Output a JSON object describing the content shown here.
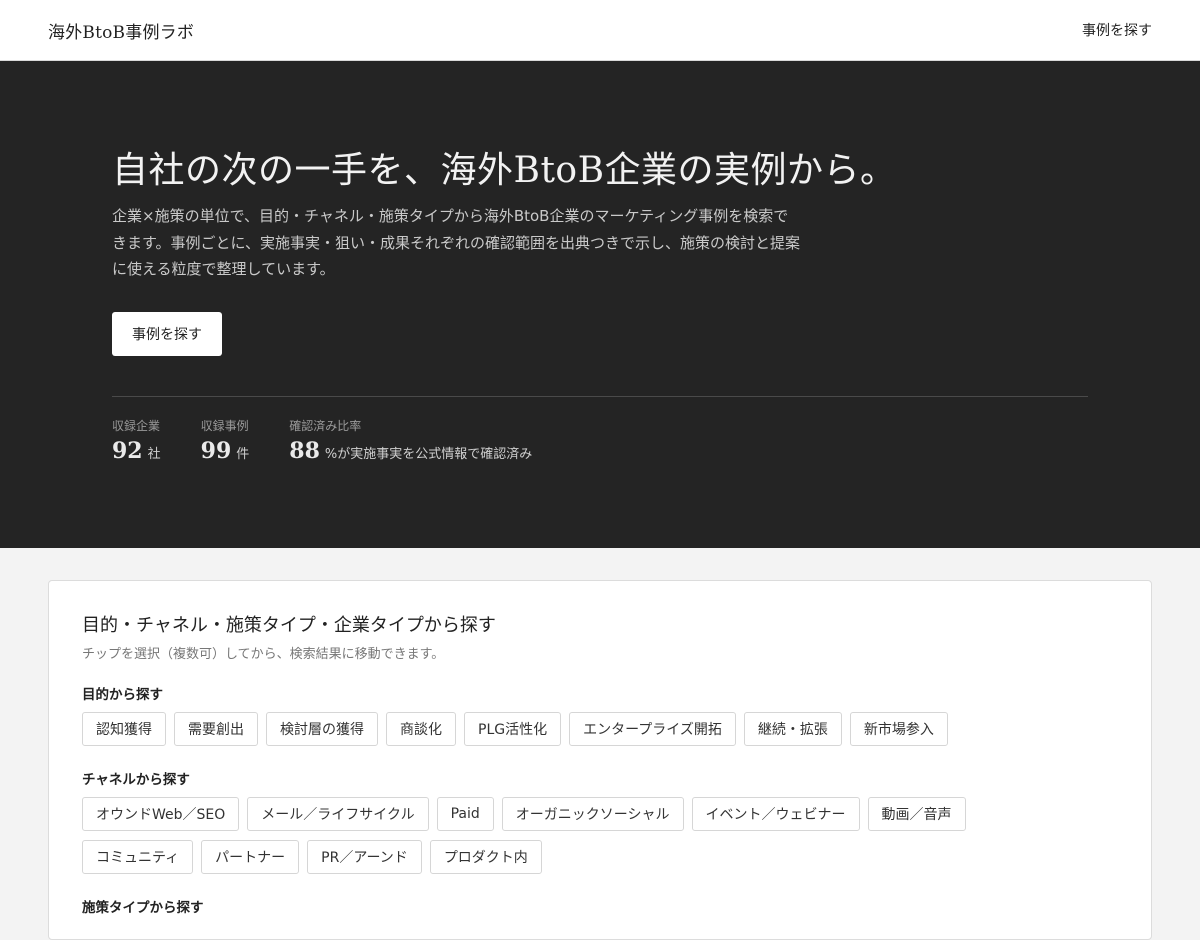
{
  "header": {
    "brand": "海外BtoB事例ラボ",
    "nav_link": "事例を探す"
  },
  "hero": {
    "title": "自社の次の一手を、海外BtoB企業の実例から。",
    "description": "企業×施策の単位で、目的・チャネル・施策タイプから海外BtoB企業のマーケティング事例を検索できます。事例ごとに、実施事実・狙い・成果それぞれの確認範囲を出典つきで示し、施策の検討と提案に使える粒度で整理しています。",
    "cta": "事例を探す",
    "stats": [
      {
        "label": "収録企業",
        "value": "92",
        "unit": "社"
      },
      {
        "label": "収録事例",
        "value": "99",
        "unit": "件"
      },
      {
        "label": "確認済み比率",
        "value": "88",
        "unit": "%が実施事実を公式情報で確認済み"
      }
    ]
  },
  "search": {
    "title": "目的・チャネル・施策タイプ・企業タイプから探す",
    "subtitle": "チップを選択（複数可）してから、検索結果に移動できます。",
    "groups": [
      {
        "title": "目的から探す",
        "chips": [
          "認知獲得",
          "需要創出",
          "検討層の獲得",
          "商談化",
          "PLG活性化",
          "エンタープライズ開拓",
          "継続・拡張",
          "新市場参入"
        ]
      },
      {
        "title": "チャネルから探す",
        "chips": [
          "オウンドWeb／SEO",
          "メール／ライフサイクル",
          "Paid",
          "オーガニックソーシャル",
          "イベント／ウェビナー",
          "動画／音声",
          "コミュニティ",
          "パートナー",
          "PR／アーンド",
          "プロダクト内"
        ]
      },
      {
        "title": "施策タイプから探す",
        "chips": []
      }
    ]
  }
}
